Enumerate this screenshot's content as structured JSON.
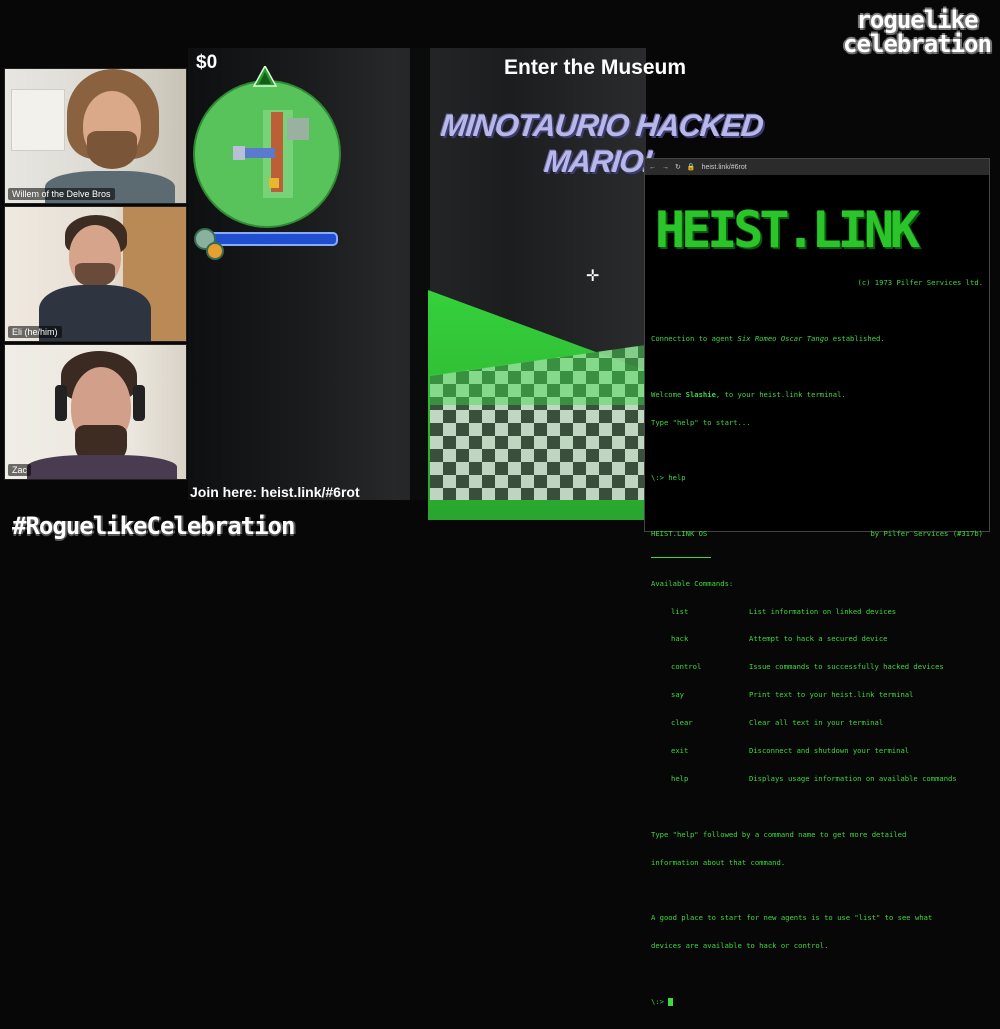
{
  "logo": {
    "line1": "roguelike",
    "line2": "celebration"
  },
  "webcams": [
    {
      "name": "Willem of the Delve Bros"
    },
    {
      "name": "Eli (he/him)"
    },
    {
      "name": "Zac"
    }
  ],
  "game": {
    "money": "$0",
    "objective": "Enter the Museum",
    "banner": "MINOTAURIO HACKED MARIO!",
    "crosshair_icon": "crosshair-icon"
  },
  "footer": {
    "join": "Join here: heist.link/#6rot",
    "hashtag": "#RoguelikeCelebration"
  },
  "browser": {
    "url": "heist.link/#6rot",
    "terminal": {
      "logo": "HEIST.LINK",
      "copyright": "(c) 1973 Pilfer Services ltd.",
      "connection_prefix": "Connection to agent ",
      "agent_name": "Six Romeo Oscar Tango",
      "connection_suffix": " established.",
      "welcome_prefix": "Welcome ",
      "user": "Slashie",
      "welcome_suffix": ", to your heist.link terminal.",
      "type_help": "Type \"help\" to start...",
      "prompt_help": "\\:> help",
      "os_name": "HEIST.LINK OS",
      "os_by": "by Pilfer Services (#317b)",
      "available": "Available Commands:",
      "commands": [
        {
          "name": "list",
          "desc": "List information on linked devices"
        },
        {
          "name": "hack",
          "desc": "Attempt to hack a secured device"
        },
        {
          "name": "control",
          "desc": "Issue commands to successfully hacked devices"
        },
        {
          "name": "say",
          "desc": "Print text to your heist.link terminal"
        },
        {
          "name": "clear",
          "desc": "Clear all text in your terminal"
        },
        {
          "name": "exit",
          "desc": "Disconnect and shutdown your terminal"
        },
        {
          "name": "help",
          "desc": "Displays usage information on available commands"
        }
      ],
      "help_hint_1": "Type \"help\" followed by a command name to get more detailed",
      "help_hint_2": "information about that command.",
      "start_hint_1": "A good place to start for new agents is to use \"list\" to see what",
      "start_hint_2": "devices are available to hack or control.",
      "prompt_empty": "\\:>"
    }
  },
  "colors": {
    "terminal_green": "#3ed93e",
    "minimap": "#57c35a",
    "health": "#1f4fd0"
  }
}
